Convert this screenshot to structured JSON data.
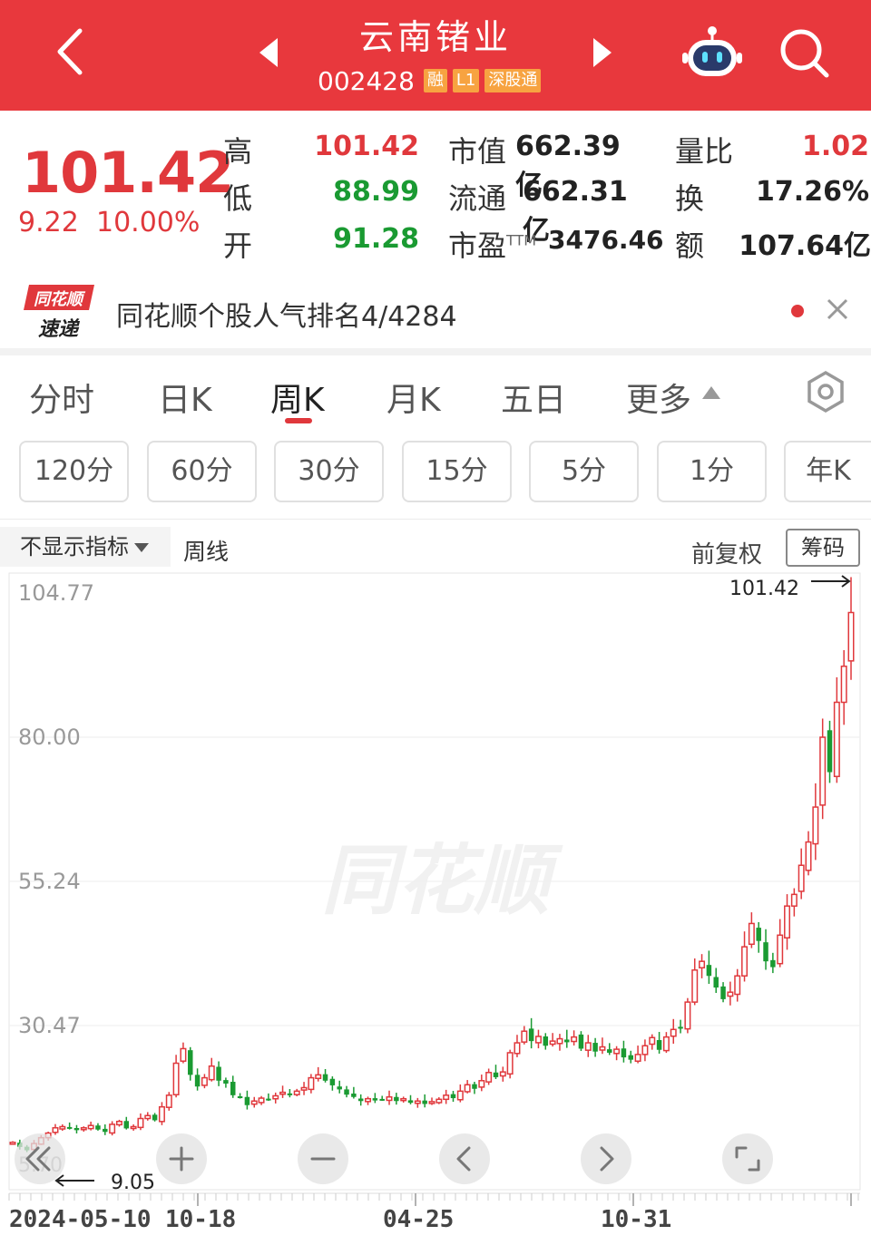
{
  "header": {
    "title": "云南锗业",
    "code": "002428",
    "tags": [
      "融",
      "L1",
      "深股通"
    ]
  },
  "quote": {
    "price": "101.42",
    "change": "9.22",
    "change_pct": "10.00%",
    "high_label": "高",
    "high": "101.42",
    "low_label": "低",
    "low": "88.99",
    "open_label": "开",
    "open": "91.28",
    "mcap_label": "市值",
    "mcap": "662.39亿",
    "float_label": "流通",
    "float": "662.31亿",
    "pe_label": "市盈",
    "pe_sup": "TTM",
    "pe": "3476.46",
    "vr_label": "量比",
    "vr": "1.02",
    "turn_label": "换",
    "turn": "17.26%",
    "amt_label": "额",
    "amt": "107.64亿"
  },
  "notice": {
    "logo_line1": "同花顺",
    "logo_line2": "速递",
    "text": "同花顺个股人气排名4/4284"
  },
  "tabs": [
    "分时",
    "日K",
    "周K",
    "月K",
    "五日",
    "更多"
  ],
  "active_tab": "周K",
  "periods": [
    "120分",
    "60分",
    "30分",
    "15分",
    "5分",
    "1分",
    "年K"
  ],
  "toolbar": {
    "indicator": "不显示指标",
    "line_type": "周线",
    "adjust": "前复权",
    "chips": "筹码"
  },
  "chart_data": {
    "type": "candlestick",
    "y_ticks": [
      "104.77",
      "80.00",
      "55.24",
      "30.47"
    ],
    "ylim": [
      5.7,
      104.77
    ],
    "bottom_tick": "5.70",
    "x_ticks": [
      "2024-05-10",
      "10-18",
      "04-25",
      "10-31"
    ],
    "max_label": "101.42",
    "min_label": "9.05",
    "watermark": "同花顺",
    "closes": [
      10.4,
      9.6,
      9.05,
      10.2,
      11.2,
      12.0,
      12.9,
      13.1,
      12.8,
      12.5,
      12.9,
      13.3,
      12.6,
      12.2,
      13.5,
      14.0,
      12.8,
      13.1,
      14.5,
      15.0,
      14.2,
      16.5,
      18.5,
      24.0,
      26.5,
      22.0,
      20.0,
      21.5,
      23.5,
      21.0,
      20.5,
      18.5,
      18.2,
      16.8,
      17.5,
      18.0,
      17.8,
      18.4,
      19.0,
      18.6,
      19.2,
      19.8,
      21.5,
      22.0,
      21.0,
      20.2,
      19.5,
      18.6,
      18.2,
      17.5,
      17.9,
      17.6,
      17.8,
      18.2,
      17.5,
      17.9,
      17.2,
      17.5,
      17.0,
      17.4,
      17.8,
      18.5,
      18.0,
      19.2,
      20.3,
      19.6,
      21.0,
      22.4,
      21.6,
      22.5,
      25.8,
      27.5,
      29.5,
      27.8,
      28.6,
      27.0,
      27.8,
      28.2,
      27.6,
      28.5,
      26.5,
      27.5,
      26.0,
      26.8,
      25.8,
      26.4,
      25.0,
      24.6,
      25.5,
      27.0,
      28.4,
      26.3,
      28.5,
      29.8,
      30.2,
      34.5,
      40.0,
      41.5,
      39.0,
      37.0,
      35.0,
      36.2,
      39.0,
      44.0,
      48.0,
      45.0,
      41.5,
      40.5,
      46.0,
      51.0,
      53.0,
      58.0,
      62.0,
      68.0,
      80.0,
      74.0,
      86.0,
      92.19,
      101.42
    ]
  },
  "chart_controls": [
    "rewind",
    "zoom-in",
    "zoom-out",
    "prev",
    "next",
    "fullscreen"
  ]
}
